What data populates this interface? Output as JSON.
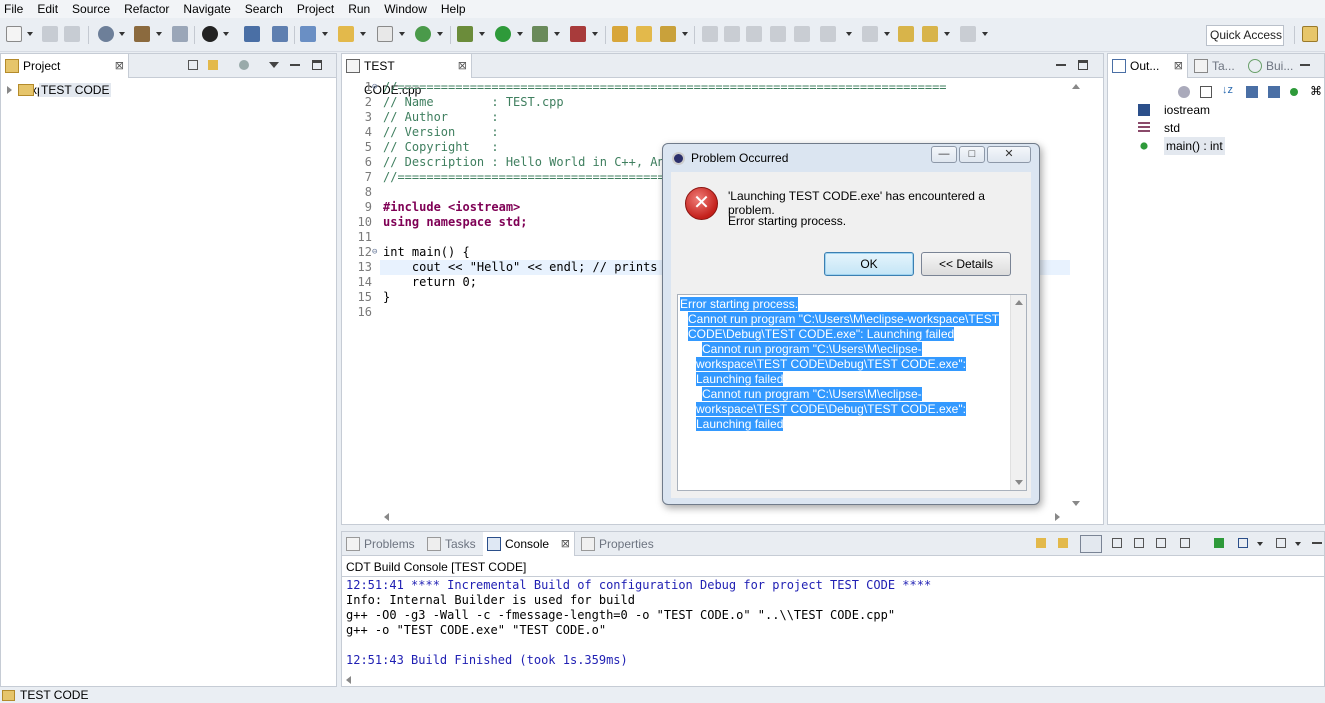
{
  "menu": [
    "File",
    "Edit",
    "Source",
    "Refactor",
    "Navigate",
    "Search",
    "Project",
    "Run",
    "Window",
    "Help"
  ],
  "toolbar": {
    "quick_access": "Quick Access"
  },
  "project_explorer": {
    "tab_label": "Project Explorer",
    "close_glyph": "⊠",
    "tree": [
      {
        "label": "TEST CODE"
      }
    ]
  },
  "editor": {
    "tab_label": "TEST CODE.cpp",
    "close_glyph": "⊠",
    "lines": [
      {
        "n": "1",
        "text": "//============================================================================"
      },
      {
        "n": "2",
        "text": "// Name        : TEST.cpp"
      },
      {
        "n": "3",
        "text": "// Author      :"
      },
      {
        "n": "4",
        "text": "// Version     :"
      },
      {
        "n": "5",
        "text": "// Copyright   :"
      },
      {
        "n": "6",
        "text": "// Description : Hello World in C++, Ans"
      },
      {
        "n": "7",
        "text": "//============================================="
      },
      {
        "n": "8",
        "text": ""
      },
      {
        "n": "9",
        "text": "#include <iostream>"
      },
      {
        "n": "10",
        "text": "using namespace std;"
      },
      {
        "n": "11",
        "text": ""
      },
      {
        "n": "12",
        "text": "int main() {"
      },
      {
        "n": "13",
        "text": "    cout << \"Hello\" << endl; // prints"
      },
      {
        "n": "14",
        "text": "    return 0;"
      },
      {
        "n": "15",
        "text": "}"
      },
      {
        "n": "16",
        "text": ""
      }
    ]
  },
  "outline": {
    "tabs": [
      {
        "label": "Out...",
        "close": "⊠"
      },
      {
        "label": "Ta..."
      },
      {
        "label": "Bui..."
      }
    ],
    "items": [
      {
        "label": "iostream",
        "icon": "include-icon"
      },
      {
        "label": "std",
        "icon": "namespace-icon"
      },
      {
        "label": "main() : int",
        "icon": "function-icon"
      }
    ]
  },
  "console": {
    "tabs": [
      {
        "label": "Problems"
      },
      {
        "label": "Tasks"
      },
      {
        "label": "Console",
        "close": "⊠"
      },
      {
        "label": "Properties"
      }
    ],
    "title": "CDT Build Console [TEST CODE]",
    "lines": [
      "12:51:41 **** Incremental Build of configuration Debug for project TEST CODE ****",
      "Info: Internal Builder is used for build",
      "g++ -O0 -g3 -Wall -c -fmessage-length=0 -o \"TEST CODE.o\" \"..\\\\TEST CODE.cpp\"",
      "g++ -o \"TEST CODE.exe\" \"TEST CODE.o\"",
      "",
      "12:51:43 Build Finished (took 1s.359ms)"
    ]
  },
  "status": {
    "text": "TEST CODE"
  },
  "dialog": {
    "title": "Problem Occurred",
    "controls": [
      "—",
      "□",
      "✕"
    ],
    "message": "'Launching TEST CODE.exe' has encountered a problem.",
    "sub_message": "Error starting process.",
    "ok_label": "OK",
    "details_label": "<< Details",
    "details": [
      {
        "indent": 0,
        "text": "Error starting process."
      },
      {
        "indent": 8,
        "text": "Cannot run program \"C:\\Users\\M\\eclipse-workspace\\TEST CODE\\Debug\\TEST CODE.exe\": Launching failed"
      },
      {
        "indent": 22,
        "text": "Cannot run program \"C:\\Users\\M\\eclipse-workspace\\TEST CODE\\Debug\\TEST CODE.exe\": Launching failed"
      },
      {
        "indent": 22,
        "text": "Cannot run program \"C:\\Users\\M\\eclipse-workspace\\TEST CODE\\Debug\\TEST CODE.exe\": Launching failed"
      }
    ]
  },
  "colors": {
    "accent": "#3399ff",
    "comment": "#3f7f5f",
    "keyword": "#7f0055",
    "string": "#2a00ff",
    "error": "#c3201b"
  }
}
